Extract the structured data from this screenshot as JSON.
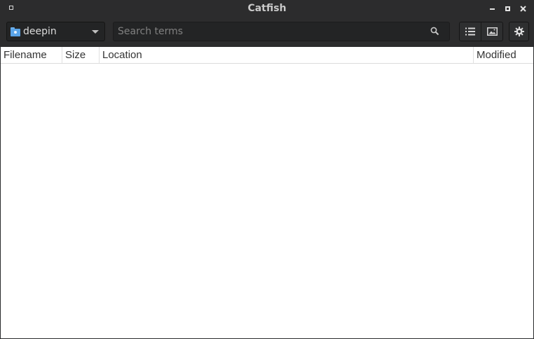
{
  "window": {
    "title": "Catfish"
  },
  "toolbar": {
    "folder": {
      "label": "deepin",
      "icon": "folder-icon"
    },
    "search": {
      "value": "",
      "placeholder": "Search terms",
      "icon": "search-icon"
    },
    "view_buttons": [
      {
        "icon": "list-view-icon"
      },
      {
        "icon": "thumbnail-view-icon"
      }
    ],
    "settings_icon": "gear-icon"
  },
  "results": {
    "columns": [
      "Filename",
      "Size",
      "Location",
      "Modified"
    ],
    "rows": []
  },
  "colors": {
    "titlebar_bg": "#2c2c2d",
    "accent_folder": "#5aa4e8",
    "results_bg": "#ffffff"
  }
}
